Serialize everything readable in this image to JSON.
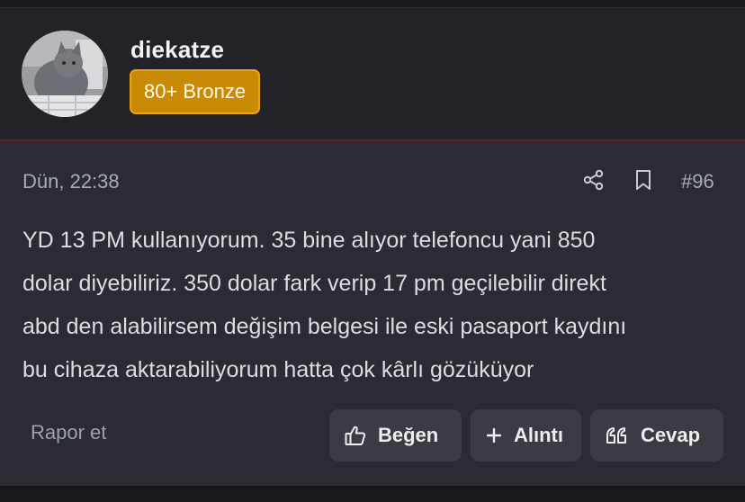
{
  "author": {
    "username": "diekatze",
    "badge": "80+ Bronze"
  },
  "post": {
    "date": "Dün, 22:38",
    "number": "#96",
    "lines": [
      "YD 13 PM kullanıyorum. 35 bine alıyor telefoncu yani 850",
      "dolar diyebiliriz. 350 dolar fark verip 17 pm geçilebilir direkt",
      "abd den alabilirsem değişim belgesi ile eski pasaport kaydını",
      "bu cihaza aktarabiliyorum hatta çok kârlı gözüküyor"
    ]
  },
  "actions": {
    "report": "Rapor et",
    "like": "Beğen",
    "quote": "Alıntı",
    "reply": "Cevap"
  },
  "icons": {
    "share": "share-icon",
    "bookmark": "bookmark-icon",
    "like": "thumbs-up-icon",
    "quote": "plus-icon",
    "reply": "quote-marks-icon"
  },
  "colors": {
    "badge_bg": "#c98a05",
    "header_bg": "#222329",
    "post_bg": "#2b2c33",
    "divider": "#6b1b22"
  }
}
